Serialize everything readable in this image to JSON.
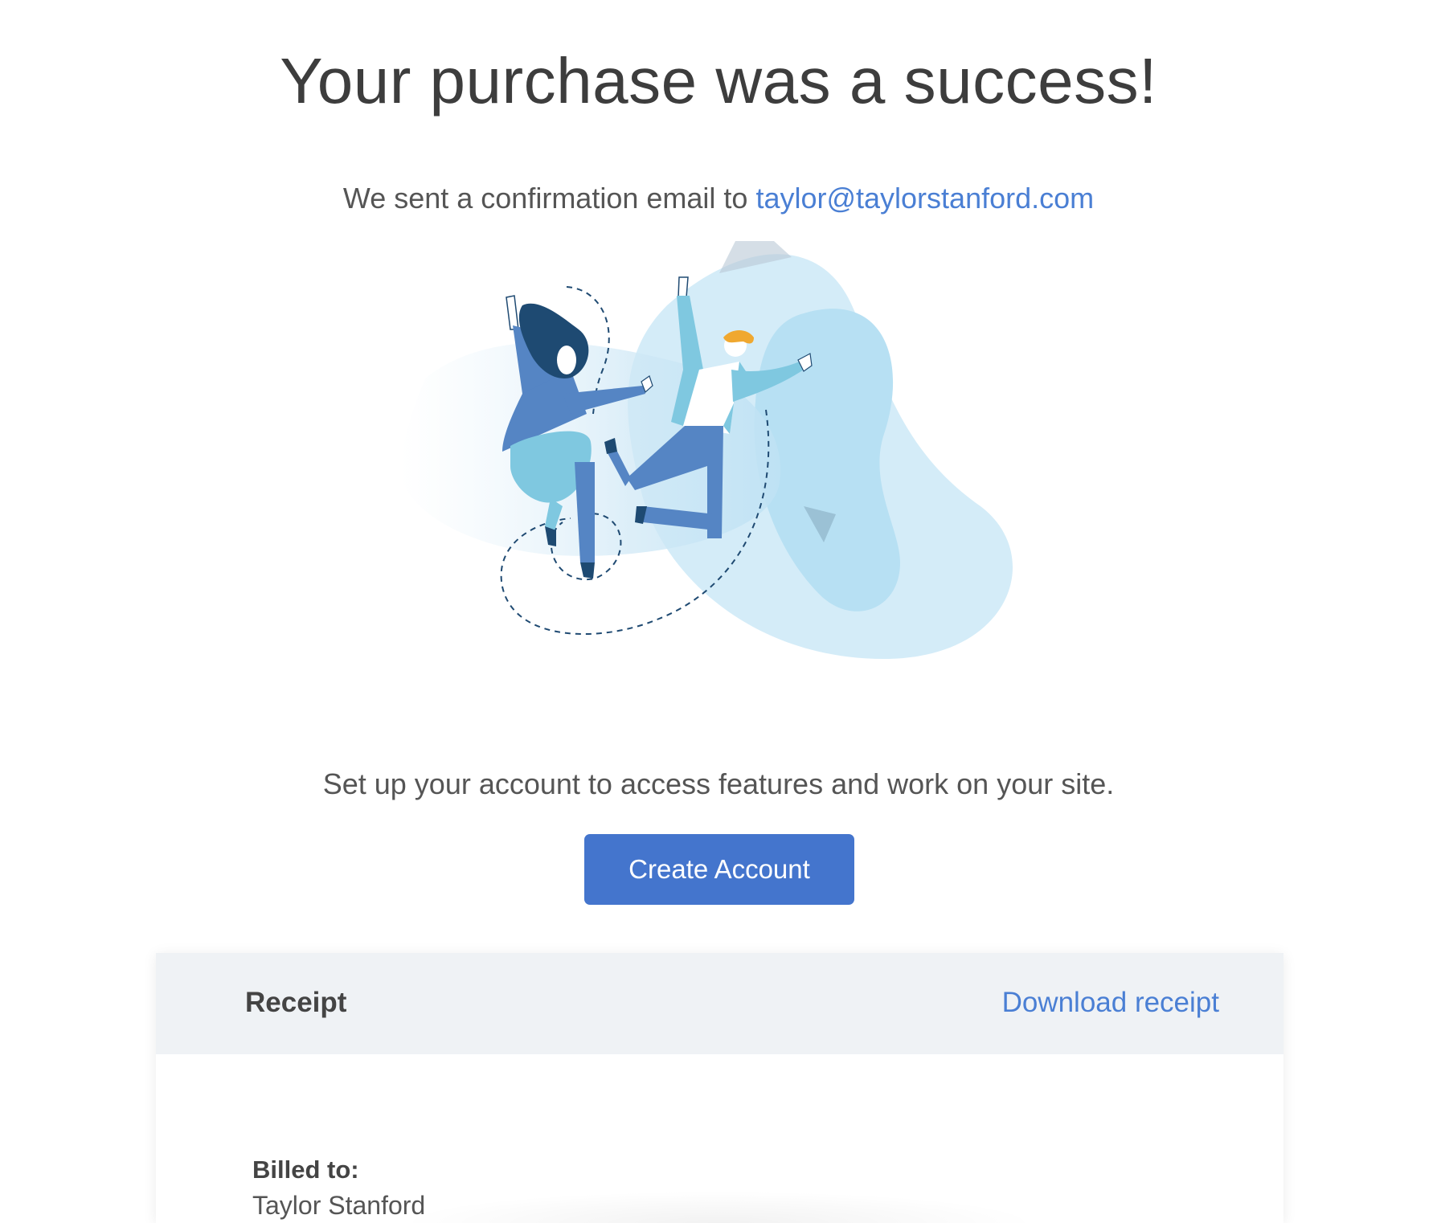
{
  "headline": "Your purchase was a success!",
  "confirmation": {
    "text": "We sent a confirmation email to",
    "email": "taylor@taylorstanford.com"
  },
  "setup_text": "Set up your account to access features and work on your site.",
  "cta_label": "Create Account",
  "receipt": {
    "title": "Receipt",
    "download_label": "Download receipt",
    "billed_label": "Billed to:",
    "billed_name": "Taylor Stanford"
  },
  "colors": {
    "accent": "#4475cd",
    "link": "#4a7fd4",
    "receipt_header_bg": "#eff2f5"
  }
}
